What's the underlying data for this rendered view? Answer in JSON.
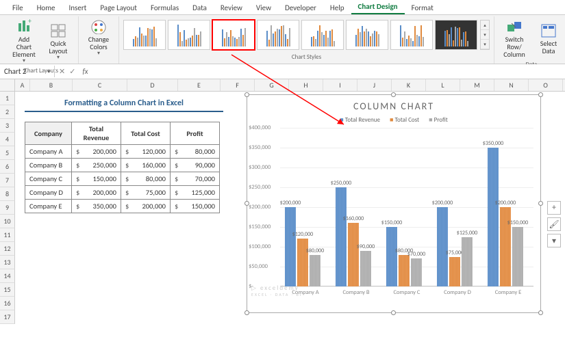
{
  "tabs": {
    "file": "File",
    "home": "Home",
    "insert": "Insert",
    "pagelayout": "Page Layout",
    "formulas": "Formulas",
    "data": "Data",
    "review": "Review",
    "view": "View",
    "developer": "Developer",
    "help": "Help",
    "chartdesign": "Chart Design",
    "format": "Format"
  },
  "ribbon": {
    "add_element": "Add Chart Element",
    "quick_layout": "Quick Layout",
    "change_colors": "Change Colors",
    "switch_row": "Switch Row/ Column",
    "select_data": "Select Data",
    "group_layouts": "Chart Layouts",
    "group_styles": "Chart Styles",
    "group_data": "Data"
  },
  "namebox": "Chart 2",
  "fx": {
    "cancel": "✕",
    "enter": "✓",
    "label": "fx"
  },
  "columns": [
    "A",
    "B",
    "C",
    "D",
    "E",
    "F",
    "G",
    "H",
    "I",
    "J",
    "K",
    "L",
    "M",
    "N",
    "O"
  ],
  "row_count": 17,
  "table": {
    "title": "Formatting a Column Chart in Excel",
    "headers": [
      "Company",
      "Total Revenue",
      "Total Cost",
      "Profit"
    ],
    "currency": "$",
    "rows": [
      {
        "company": "Company A",
        "rev": "200,000",
        "cost": "120,000",
        "profit": "80,000"
      },
      {
        "company": "Company B",
        "rev": "250,000",
        "cost": "160,000",
        "profit": "90,000"
      },
      {
        "company": "Company C",
        "rev": "150,000",
        "cost": "80,000",
        "profit": "70,000"
      },
      {
        "company": "Company D",
        "rev": "200,000",
        "cost": "75,000",
        "profit": "125,000"
      },
      {
        "company": "Company E",
        "rev": "350,000",
        "cost": "200,000",
        "profit": "150,000"
      }
    ]
  },
  "chart": {
    "title": "COLUMN CHART",
    "legend": [
      "Total Revenue",
      "Total Cost",
      "Profit"
    ],
    "watermark": "exceldemy",
    "watermark_sub": "EXCEL · DATA · BI"
  },
  "side_btns": {
    "plus": "+",
    "brush": "🖌",
    "funnel": "▾"
  },
  "chart_data": {
    "type": "bar",
    "title": "COLUMN CHART",
    "categories": [
      "Company A",
      "Company B",
      "Company C",
      "Company D",
      "Company E"
    ],
    "series": [
      {
        "name": "Total Revenue",
        "values": [
          200000,
          250000,
          150000,
          200000,
          350000
        ],
        "color": "#5a8dc8"
      },
      {
        "name": "Total Cost",
        "values": [
          120000,
          160000,
          80000,
          75000,
          200000
        ],
        "color": "#e08a3e"
      },
      {
        "name": "Profit",
        "values": [
          80000,
          90000,
          70000,
          125000,
          150000
        ],
        "color": "#aaaaaa"
      }
    ],
    "ylim": [
      0,
      400000
    ],
    "yticks": [
      "$-",
      "$50,000",
      "$100,000",
      "$150,000",
      "$200,000",
      "$250,000",
      "$300,000",
      "$350,000",
      "$400,000"
    ],
    "data_labels": [
      [
        "$200,000",
        "$120,000",
        "$80,000"
      ],
      [
        "$250,000",
        "$160,000",
        "$90,000"
      ],
      [
        "$150,000",
        "$80,000",
        "$70,000"
      ],
      [
        "$200,000",
        "$75,000",
        "$125,000"
      ],
      [
        "$350,000",
        "$200,000",
        "$150,000"
      ]
    ]
  }
}
